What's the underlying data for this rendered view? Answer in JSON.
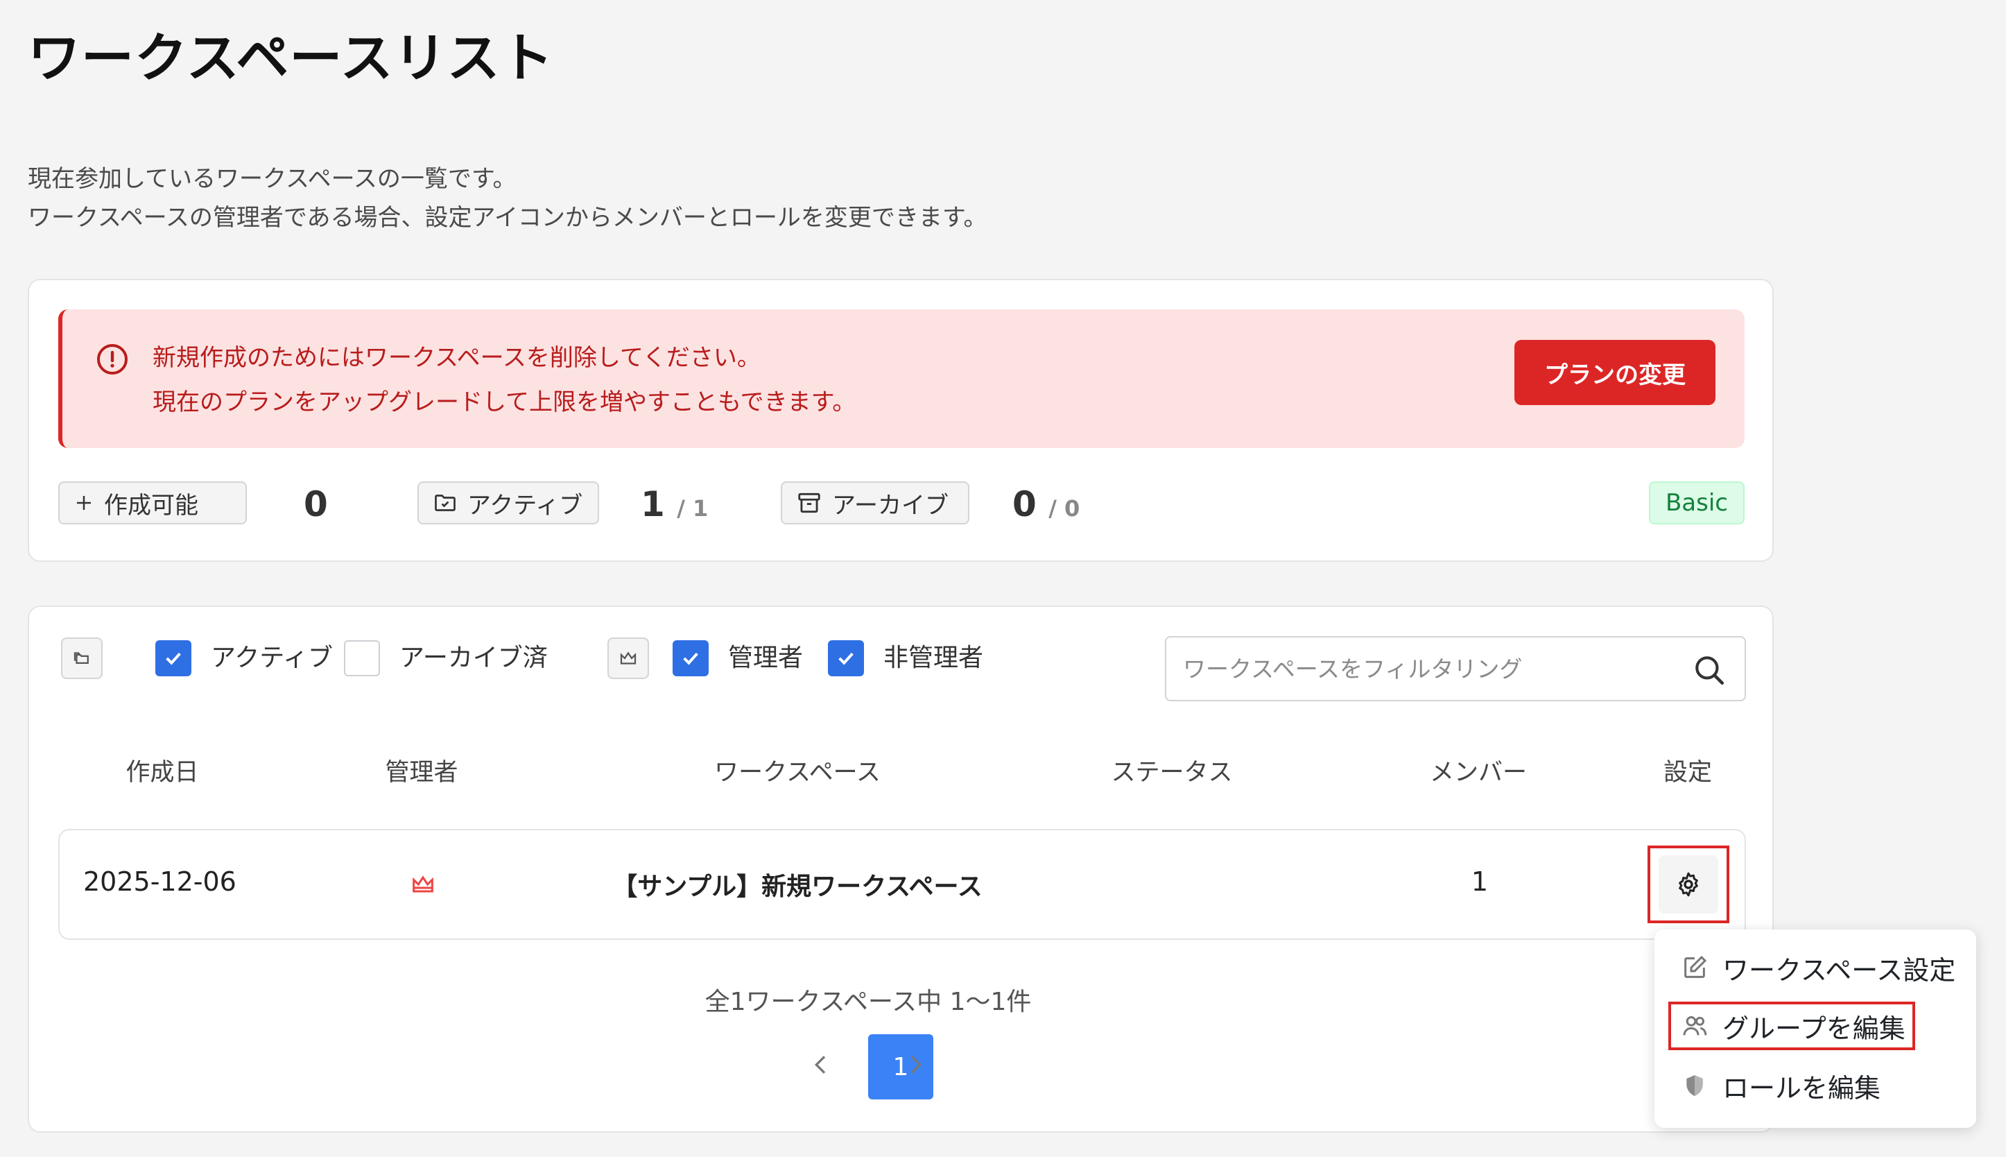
{
  "page": {
    "title": "ワークスペースリスト",
    "description_line1": "現在参加しているワークスペースの一覧です。",
    "description_line2": "ワークスペースの管理者である場合、設定アイコンからメンバーとロールを変更できます。"
  },
  "alert": {
    "line1": "新規作成のためにはワークスペースを削除してください。",
    "line2": "現在のプランをアップグレードして上限を増やすこともできます。",
    "button_label": "プランの変更",
    "color": "#dc2626"
  },
  "stats": {
    "creatable_label": "作成可能",
    "creatable_value": "0",
    "active_label": "アクティブ",
    "active_value": "1",
    "active_total": "/ 1",
    "archive_label": "アーカイブ",
    "archive_value": "0",
    "archive_total": "/ 0",
    "plan_badge": "Basic"
  },
  "filters": {
    "active_label": "アクティブ",
    "active_checked": true,
    "archived_label": "アーカイブ済",
    "archived_checked": false,
    "admin_label": "管理者",
    "admin_checked": true,
    "non_admin_label": "非管理者",
    "non_admin_checked": true,
    "search_placeholder": "ワークスペースをフィルタリング"
  },
  "table": {
    "columns": [
      "作成日",
      "管理者",
      "ワークスペース",
      "ステータス",
      "メンバー",
      "設定"
    ],
    "rows": [
      {
        "created": "2025-12-06",
        "admin_icon": "crown-icon",
        "workspace": "【サンプル】新規ワークスペース",
        "status": "",
        "members": "1",
        "settings_icon": "gear-icon"
      }
    ]
  },
  "pagination": {
    "summary": "全1ワークスペース中 1〜1件",
    "current_page": "1"
  },
  "menu": {
    "items": [
      {
        "label": "ワークスペース設定",
        "icon": "edit-icon"
      },
      {
        "label": "グループを編集",
        "icon": "users-icon"
      },
      {
        "label": "ロールを編集",
        "icon": "shield-icon"
      }
    ]
  },
  "colors": {
    "accent_blue": "#2f6fe4",
    "page_blue": "#3b82f6",
    "danger": "#dc2626",
    "badge_green": "#15803d"
  }
}
